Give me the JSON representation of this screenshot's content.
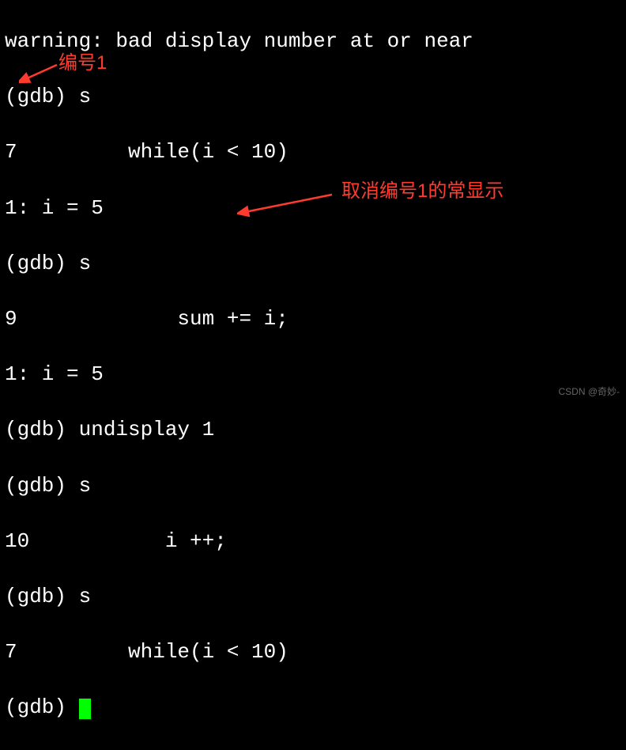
{
  "lines": {
    "l0": "warning: bad display number at or near",
    "l1": "(gdb) s",
    "l2": "7         while(i < 10)",
    "l3": "1: i = 5",
    "l4": "(gdb) s",
    "l5": "9             sum += i;",
    "l6": "1: i = 5",
    "l7": "(gdb) undisplay 1",
    "l8": "(gdb) s",
    "l9": "10           i ++;",
    "l10": "(gdb) s",
    "l11": "7         while(i < 10)",
    "l12": "(gdb) "
  },
  "annotations": {
    "a1": "编号1",
    "a2": "取消编号1的常显示"
  },
  "watermark": "CSDN @奇妙-"
}
